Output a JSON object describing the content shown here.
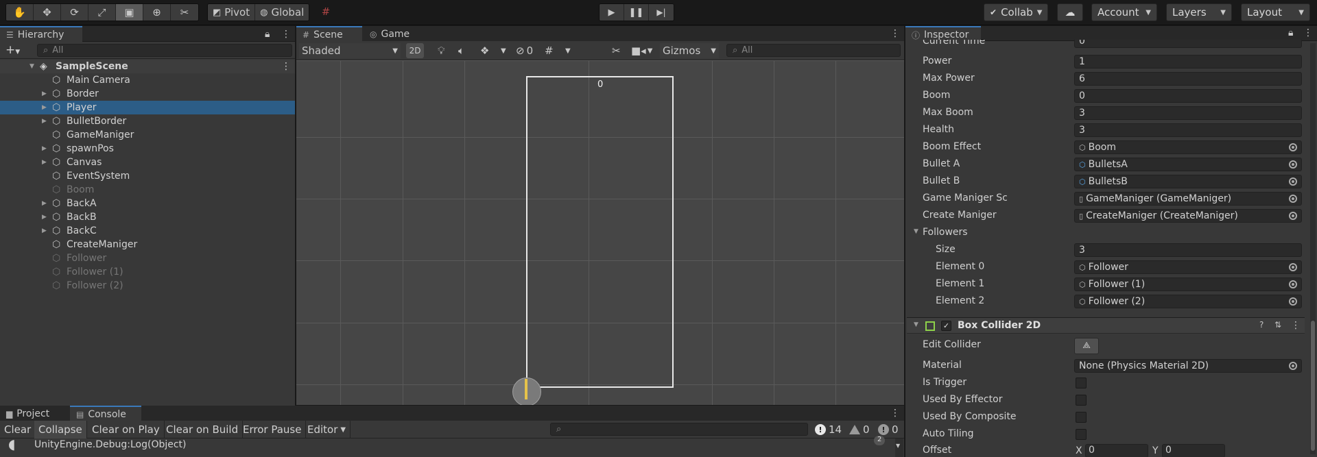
{
  "toolbar": {
    "tools": [
      "hand-icon",
      "move-icon",
      "rotate-icon",
      "scale-icon",
      "rect-icon",
      "transform-icon",
      "custom-tool-icon"
    ],
    "active_tool": 4,
    "pivot": "Pivot",
    "global": "Global",
    "collab": "Collab",
    "account": "Account",
    "layers": "Layers",
    "layout": "Layout"
  },
  "hierarchy": {
    "tab": "Hierarchy",
    "search_placeholder": "All",
    "scene": "SampleScene",
    "items": [
      {
        "label": "Main Camera",
        "expandable": false,
        "state": "normal"
      },
      {
        "label": "Border",
        "expandable": true,
        "state": "normal"
      },
      {
        "label": "Player",
        "expandable": true,
        "state": "selected"
      },
      {
        "label": "BulletBorder",
        "expandable": true,
        "state": "normal"
      },
      {
        "label": "GameManiger",
        "expandable": false,
        "state": "normal"
      },
      {
        "label": "spawnPos",
        "expandable": true,
        "state": "normal"
      },
      {
        "label": "Canvas",
        "expandable": true,
        "state": "normal"
      },
      {
        "label": "EventSystem",
        "expandable": false,
        "state": "normal"
      },
      {
        "label": "Boom",
        "expandable": false,
        "state": "dim"
      },
      {
        "label": "BackA",
        "expandable": true,
        "state": "normal"
      },
      {
        "label": "BackB",
        "expandable": true,
        "state": "normal"
      },
      {
        "label": "BackC",
        "expandable": true,
        "state": "normal"
      },
      {
        "label": "CreateManiger",
        "expandable": false,
        "state": "normal"
      },
      {
        "label": "Follower",
        "expandable": false,
        "state": "dim"
      },
      {
        "label": "Follower (1)",
        "expandable": false,
        "state": "dim"
      },
      {
        "label": "Follower (2)",
        "expandable": false,
        "state": "dim"
      }
    ]
  },
  "scene": {
    "tab_scene": "Scene",
    "tab_game": "Game",
    "shading": "Shaded",
    "mode_2d": "2D",
    "hidden_count": "0",
    "gizmos": "Gizmos",
    "search_placeholder": "All",
    "score_text": "0"
  },
  "inspector": {
    "tab": "Inspector",
    "fields": [
      {
        "name": "Current Time",
        "value": "0",
        "type": "text"
      },
      {
        "name": "Power",
        "value": "1",
        "type": "text"
      },
      {
        "name": "Max Power",
        "value": "6",
        "type": "text"
      },
      {
        "name": "Boom",
        "value": "0",
        "type": "text"
      },
      {
        "name": "Max Boom",
        "value": "3",
        "type": "text"
      },
      {
        "name": "Health",
        "value": "3",
        "type": "text"
      },
      {
        "name": "Boom Effect",
        "value": "Boom",
        "type": "object"
      },
      {
        "name": "Bullet A",
        "value": "BulletsA",
        "type": "prefab"
      },
      {
        "name": "Bullet B",
        "value": "BulletsB",
        "type": "prefab"
      },
      {
        "name": "Game Maniger Sc",
        "value": "GameManiger (GameManiger)",
        "type": "script"
      },
      {
        "name": "Create Maniger",
        "value": "CreateManiger (CreateManiger)",
        "type": "script"
      }
    ],
    "followers_label": "Followers",
    "size_label": "Size",
    "size_value": "3",
    "elements": [
      {
        "name": "Element 0",
        "value": "Follower"
      },
      {
        "name": "Element 1",
        "value": "Follower (1)"
      },
      {
        "name": "Element 2",
        "value": "Follower (2)"
      }
    ],
    "component_title": "Box Collider 2D",
    "collider": {
      "edit_collider": "Edit Collider",
      "material_label": "Material",
      "material_value": "None (Physics Material 2D)",
      "is_trigger": "Is Trigger",
      "used_by_effector": "Used By Effector",
      "used_by_composite": "Used By Composite",
      "auto_tiling": "Auto Tiling",
      "offset": "Offset",
      "offset_x_label": "X",
      "offset_x": "0",
      "offset_y_label": "Y",
      "offset_y": "0"
    }
  },
  "console": {
    "tab_project": "Project",
    "tab_console": "Console",
    "clear": "Clear",
    "collapse": "Collapse",
    "clear_on_play": "Clear on Play",
    "clear_on_build": "Clear on Build",
    "error_pause": "Error Pause",
    "editor": "Editor",
    "log_count": "14",
    "warn_count": "0",
    "error_count": "0",
    "entry": "UnityEngine.Debug:Log(Object)",
    "entry_count": "2"
  }
}
